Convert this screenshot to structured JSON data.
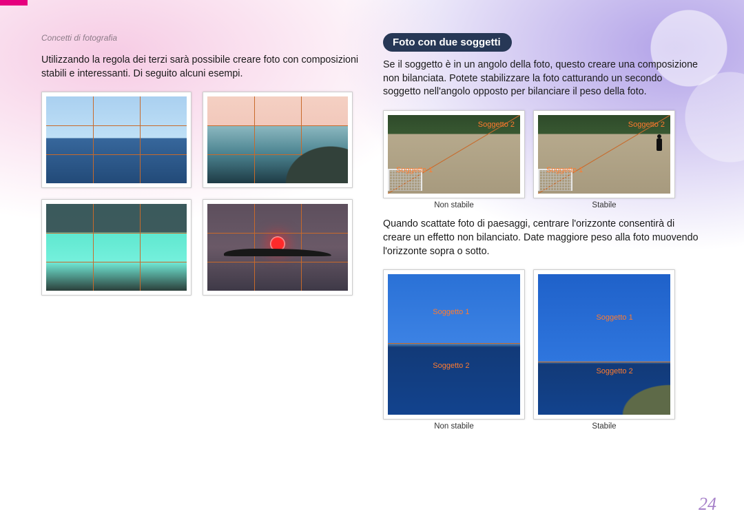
{
  "breadcrumb": "Concetti di fotografia",
  "left": {
    "intro": "Utilizzando la regola dei terzi sarà possibile creare foto con composizioni stabili e interessanti. Di seguito alcuni esempi."
  },
  "right": {
    "heading": "Foto con due soggetti",
    "para1": "Se il soggetto è in un angolo della foto, questo creare una composizione non bilanciata. Potete stabilizzare la foto catturando un secondo soggetto nell'angolo opposto per bilanciare il peso della foto.",
    "para2": "Quando scattate foto di paesaggi, centrare l'orizzonte consentirà di creare un effetto non bilanciato. Date maggiore peso alla foto muovendo l'orizzonte sopra o sotto."
  },
  "labels": {
    "sub1": "Soggetto 1",
    "sub2": "Soggetto 2",
    "unstable": "Non stabile",
    "stable": "Stabile"
  },
  "page_number": "24"
}
